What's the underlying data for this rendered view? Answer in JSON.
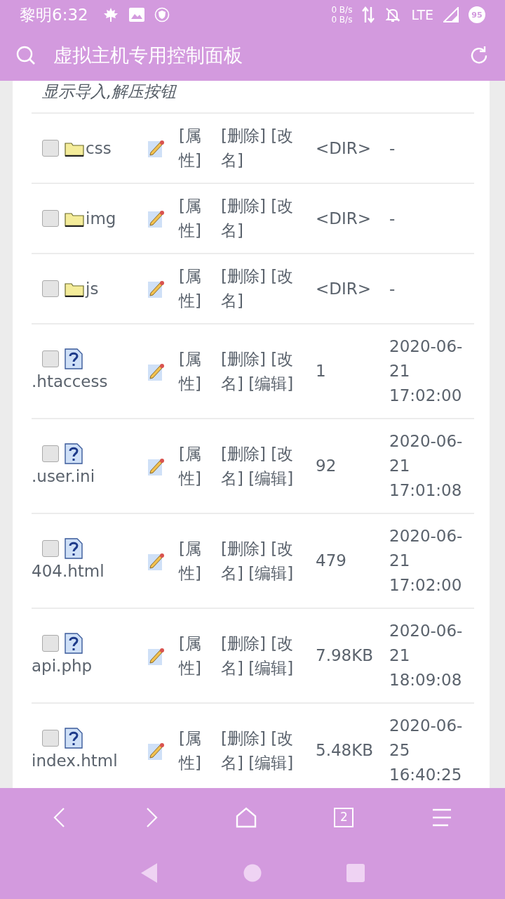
{
  "status_bar": {
    "time": "黎明6:32",
    "net_up": "0 B/s",
    "net_down": "0 B/s",
    "network": "LTE",
    "battery": "95"
  },
  "toolbar": {
    "title": "虚拟主机专用控制面板"
  },
  "notice": "显示导入,解压按钮",
  "files": [
    {
      "kind": "folder",
      "checked": false,
      "name": "css",
      "attrib": "[属性]",
      "actions": "[删除] [改名]",
      "size": "<DIR>",
      "time": "-"
    },
    {
      "kind": "folder",
      "checked": false,
      "name": "img",
      "attrib": "[属性]",
      "actions": "[删除] [改名]",
      "size": "<DIR>",
      "time": "-"
    },
    {
      "kind": "folder",
      "checked": false,
      "name": "js",
      "attrib": "[属性]",
      "actions": "[删除] [改名]",
      "size": "<DIR>",
      "time": "-"
    },
    {
      "kind": "file",
      "checked": false,
      "name": ".htaccess",
      "attrib": "[属性]",
      "actions": "[删除] [改名] [编辑]",
      "size": "1",
      "time": "2020-06-21 17:02:00"
    },
    {
      "kind": "file",
      "checked": false,
      "name": ".user.ini",
      "attrib": "[属性]",
      "actions": "[删除] [改名] [编辑]",
      "size": "92",
      "time": "2020-06-21 17:01:08"
    },
    {
      "kind": "file",
      "checked": false,
      "name": "404.html",
      "attrib": "[属性]",
      "actions": "[删除] [改名] [编辑]",
      "size": "479",
      "time": "2020-06-21 17:02:00"
    },
    {
      "kind": "file",
      "checked": false,
      "name": "api.php",
      "attrib": "[属性]",
      "actions": "[删除] [改名] [编辑]",
      "size": "7.98KB",
      "time": "2020-06-21 18:09:08"
    },
    {
      "kind": "file",
      "checked": false,
      "name": "index.html",
      "attrib": "[属性]",
      "actions": "[删除] [改名] [编辑]",
      "size": "5.48KB",
      "time": "2020-06-25 16:40:25"
    }
  ],
  "bottom_nav": {
    "tab_count": "2"
  }
}
